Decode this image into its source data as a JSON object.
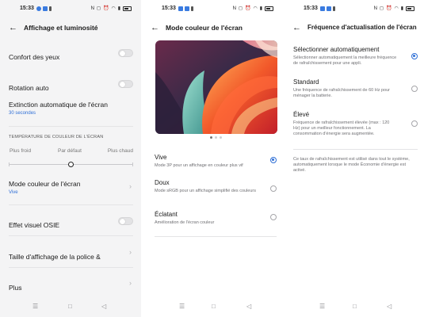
{
  "status": {
    "time": "15:33"
  },
  "colors": {
    "accent": "#2f6fd6"
  },
  "screen1": {
    "title": "Affichage et luminosité",
    "eye_comfort": "Confort des yeux",
    "auto_rotate": "Rotation auto",
    "auto_off": "Extinction automatique de l'écran",
    "auto_off_value": "30 secondes",
    "temp_section": "TEMPÉRATURE DE COULEUR DE L'ÉCRAN",
    "temp_cool": "Plus froid",
    "temp_default": "Par défaut",
    "temp_warm": "Plus chaud",
    "color_mode": "Mode couleur de l'écran",
    "color_mode_value": "Vive",
    "osie": "Effet visuel OSIE",
    "font_size": "Taille d'affichage de la police &",
    "more": "Plus"
  },
  "screen2": {
    "title": "Mode couleur de l'écran",
    "options": [
      {
        "label": "Vive",
        "desc": "Mode 3P pour un affichage en couleur plus vif",
        "selected": true
      },
      {
        "label": "Doux",
        "desc": "Mode sRGB pour un affichage simplifié des couleurs",
        "selected": false
      },
      {
        "label": "Éclatant",
        "desc": "Amélioration de l'écran couleur",
        "selected": false
      }
    ]
  },
  "screen3": {
    "title": "Fréquence d'actualisation de l'écran",
    "options": [
      {
        "label": "Sélectionner automatiquement",
        "desc": "Sélectionner automatiquement la meilleure fréquence de rafraîchissement pour une appli.",
        "selected": true
      },
      {
        "label": "Standard",
        "desc": "Une fréquence de rafraîchissement de 60 Hz pour ménager la batterie.",
        "selected": false
      },
      {
        "label": "Élevé",
        "desc": "Fréquence de rafraîchissement élevée (max : 120 Hz) pour un meilleur fonctionnement. La consommation d'énergie sera augmentée.",
        "selected": false
      }
    ],
    "note": "Ce taux de rafraîchissement est utilisé dans tout le système, automatiquement lorsque le mode Économie d'énergie est activé."
  },
  "icons": {
    "back": "arrow-left-icon",
    "chevron": "chevron-right-icon",
    "nav_menu": "menu-icon",
    "nav_home": "home-icon",
    "nav_back": "back-triangle-icon"
  }
}
